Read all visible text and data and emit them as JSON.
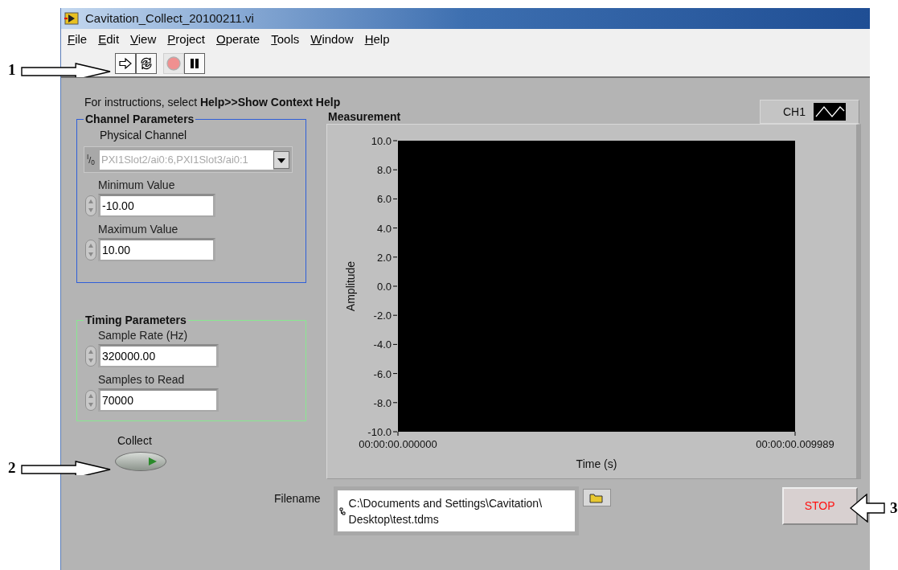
{
  "window": {
    "title": "Cavitation_Collect_20100211.vi"
  },
  "menu": [
    {
      "label": "File"
    },
    {
      "label": "Edit"
    },
    {
      "label": "View"
    },
    {
      "label": "Project"
    },
    {
      "label": "Operate"
    },
    {
      "label": "Tools"
    },
    {
      "label": "Window"
    },
    {
      "label": "Help"
    }
  ],
  "toolbar": [
    {
      "kind": "run",
      "disabled": false
    },
    {
      "kind": "run-continuously",
      "disabled": false
    },
    {
      "kind": "abort",
      "disabled": true
    },
    {
      "kind": "pause",
      "disabled": false
    }
  ],
  "instructions": "For instructions, select **Help>>Show Context Help**",
  "channel_parameters": {
    "title": "Channel Parameters",
    "physical_channel": {
      "label": "Physical Channel",
      "io_label": "$^{I}$/$_{0}$",
      "value": "PXI1Slot2/ai0:6,PXI1Slot3/ai0:1",
      "disabled": true
    },
    "fields": [
      {
        "label": "Minimum Value",
        "value": "-10.00"
      },
      {
        "label": "Maximum Value",
        "value": "10.00"
      }
    ]
  },
  "timing_parameters": {
    "title": "Timing Parameters",
    "fields": [
      {
        "label": "Sample Rate (Hz)",
        "value": "320000.00"
      },
      {
        "label": "Samples to Read",
        "value": "70000"
      }
    ]
  },
  "collect": {
    "label": "Collect",
    "on": false
  },
  "graph": {
    "title": "Measurement",
    "legend": {
      "label": "CH1"
    },
    "chart_data": {
      "type": "line",
      "xlabel": "Time (s)",
      "ylabel": "Amplitude",
      "ylim": [
        -10,
        10
      ],
      "yticks": [
        {
          "value": 10,
          "label": "10.0"
        },
        {
          "value": 8,
          "label": "8.0"
        },
        {
          "value": 6,
          "label": "6.0"
        },
        {
          "value": 4,
          "label": "4.0"
        },
        {
          "value": 2,
          "label": "2.0"
        },
        {
          "value": 0,
          "label": "0.0"
        },
        {
          "value": -2,
          "label": "-2.0"
        },
        {
          "value": -4,
          "label": "-4.0"
        },
        {
          "value": -6,
          "label": "-6.0"
        },
        {
          "value": -8,
          "label": "-8.0"
        },
        {
          "value": -10,
          "label": "-10.0"
        }
      ],
      "categories": [
        "00:00:00.000000",
        "00:00:00.009989"
      ]
    }
  },
  "filename": {
    "label": "Filename",
    "lines": [
      "C:\\Documents and Settings\\Cavitation\\",
      "Desktop\\test.tdms"
    ]
  },
  "stop": {
    "label": "STOP"
  },
  "annotations": [
    {
      "label": "1"
    },
    {
      "label": "2"
    },
    {
      "label": "3"
    }
  ]
}
